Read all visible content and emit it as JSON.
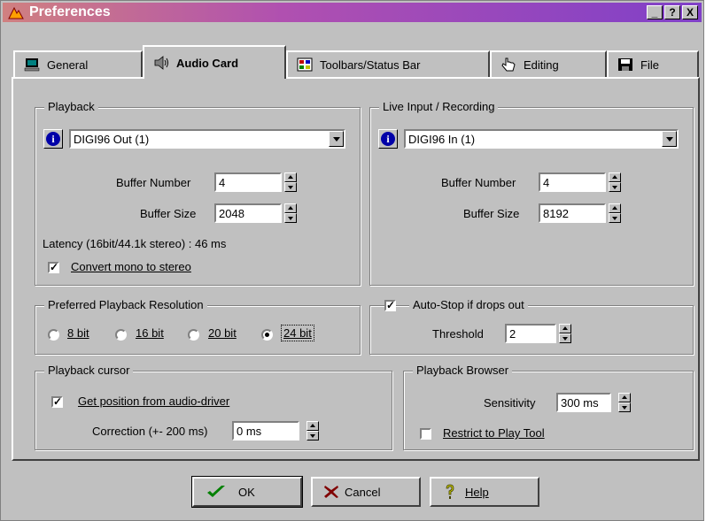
{
  "window": {
    "title": "Preferences",
    "minimize_label": "_",
    "help_label": "?",
    "close_label": "X"
  },
  "tabs": [
    {
      "label": "General",
      "icon": "computer-icon"
    },
    {
      "label": "Audio Card",
      "icon": "speaker-icon",
      "active": true
    },
    {
      "label": "Toolbars/Status Bar",
      "icon": "toolbar-icon"
    },
    {
      "label": "Editing",
      "icon": "hand-pointer-icon"
    },
    {
      "label": "File",
      "icon": "floppy-disk-icon"
    }
  ],
  "playback": {
    "legend": "Playback",
    "device": "DIGI96 Out (1)",
    "buffer_number_label": "Buffer Number",
    "buffer_number": "4",
    "buffer_size_label": "Buffer Size",
    "buffer_size": "2048",
    "latency_text": "Latency (16bit/44.1k stereo) : 46 ms",
    "convert_mono_label": "Convert mono to stereo",
    "convert_mono_checked": true
  },
  "live_input": {
    "legend": "Live Input / Recording",
    "device": "DIGI96 In (1)",
    "buffer_number_label": "Buffer Number",
    "buffer_number": "4",
    "buffer_size_label": "Buffer Size",
    "buffer_size": "8192"
  },
  "resolution": {
    "legend": "Preferred Playback Resolution",
    "options": [
      "8 bit",
      "16 bit",
      "20 bit",
      "24 bit"
    ],
    "selected": "24 bit"
  },
  "autostop": {
    "label": "Auto-Stop if drops out",
    "checked": true,
    "threshold_label": "Threshold",
    "threshold": "2"
  },
  "cursor": {
    "legend": "Playback cursor",
    "get_position_label": "Get position from audio-driver",
    "get_position_checked": true,
    "correction_label": "Correction (+- 200 ms)",
    "correction": "0 ms"
  },
  "browser": {
    "legend": "Playback Browser",
    "sensitivity_label": "Sensitivity",
    "sensitivity": "300 ms",
    "restrict_label": "Restrict to Play Tool",
    "restrict_checked": false
  },
  "buttons": {
    "ok": "OK",
    "cancel": "Cancel",
    "help": "Help"
  },
  "colors": {
    "face": "#c0c0c0",
    "title_start": "#d08080",
    "title_end": "#8040c8",
    "info": "#0000a8"
  }
}
